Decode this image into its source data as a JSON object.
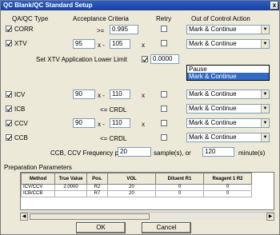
{
  "window": {
    "title": "QC Blank/QC Standard Setup",
    "close": "x"
  },
  "headers": {
    "type": "QA/QC Type",
    "criteria": "Acceptance Criteria",
    "retry": "Retry",
    "action": "Out of Control Action"
  },
  "rows": [
    {
      "name": "CORR",
      "checked": true,
      "low": "",
      "op": ">=",
      "high": "0.995",
      "unit": "",
      "retry": false,
      "action": "Mark & Continue"
    },
    {
      "name": "XTV",
      "checked": true,
      "low": "95",
      "op": "x -",
      "high": "105",
      "unit": "x",
      "retry": false,
      "action": "Mark & Continue"
    },
    {
      "name": "ICV",
      "checked": true,
      "low": "90",
      "op": "x -",
      "high": "110",
      "unit": "x",
      "retry": false,
      "action": "Mark & Continue"
    },
    {
      "name": "ICB",
      "checked": true,
      "low": "",
      "op": "<= CRDL",
      "high": "",
      "unit": "",
      "retry": false,
      "action": "Mark & Continue"
    },
    {
      "name": "CCV",
      "checked": true,
      "low": "90",
      "op": "x -",
      "high": "110",
      "unit": "x",
      "retry": false,
      "action": "Mark & Continue"
    },
    {
      "name": "CCB",
      "checked": true,
      "low": "",
      "op": "<= CRDL",
      "high": "",
      "unit": "",
      "retry": false,
      "action": "Mark & Continue"
    }
  ],
  "xtv_lower_limit": {
    "label": "Set XTV Application Lower Limit",
    "checked": true,
    "value": "0.0000"
  },
  "dropdown_open": {
    "options": [
      "Pause",
      "Mark & Continue"
    ],
    "selected_index": 1
  },
  "frequency": {
    "label": "CCB, CCV Frequency  per",
    "samples_value": "20",
    "samples_unit": "sample(s), or",
    "minutes_value": "120",
    "minutes_unit": "minute(s)"
  },
  "prep": {
    "label": "Preparation Parameters",
    "columns": [
      "Method",
      "True Value",
      "Pos.",
      "VOL",
      "Diluent R1",
      "Reagent 1 R2"
    ],
    "rows": [
      [
        "ICV/CCV",
        "2.0000",
        "R2",
        "20",
        "0",
        "0"
      ],
      [
        "ICB/CCB",
        "",
        "R7",
        "20",
        "0",
        "0"
      ]
    ]
  },
  "buttons": {
    "ok": "OK",
    "cancel": "Cancel"
  }
}
